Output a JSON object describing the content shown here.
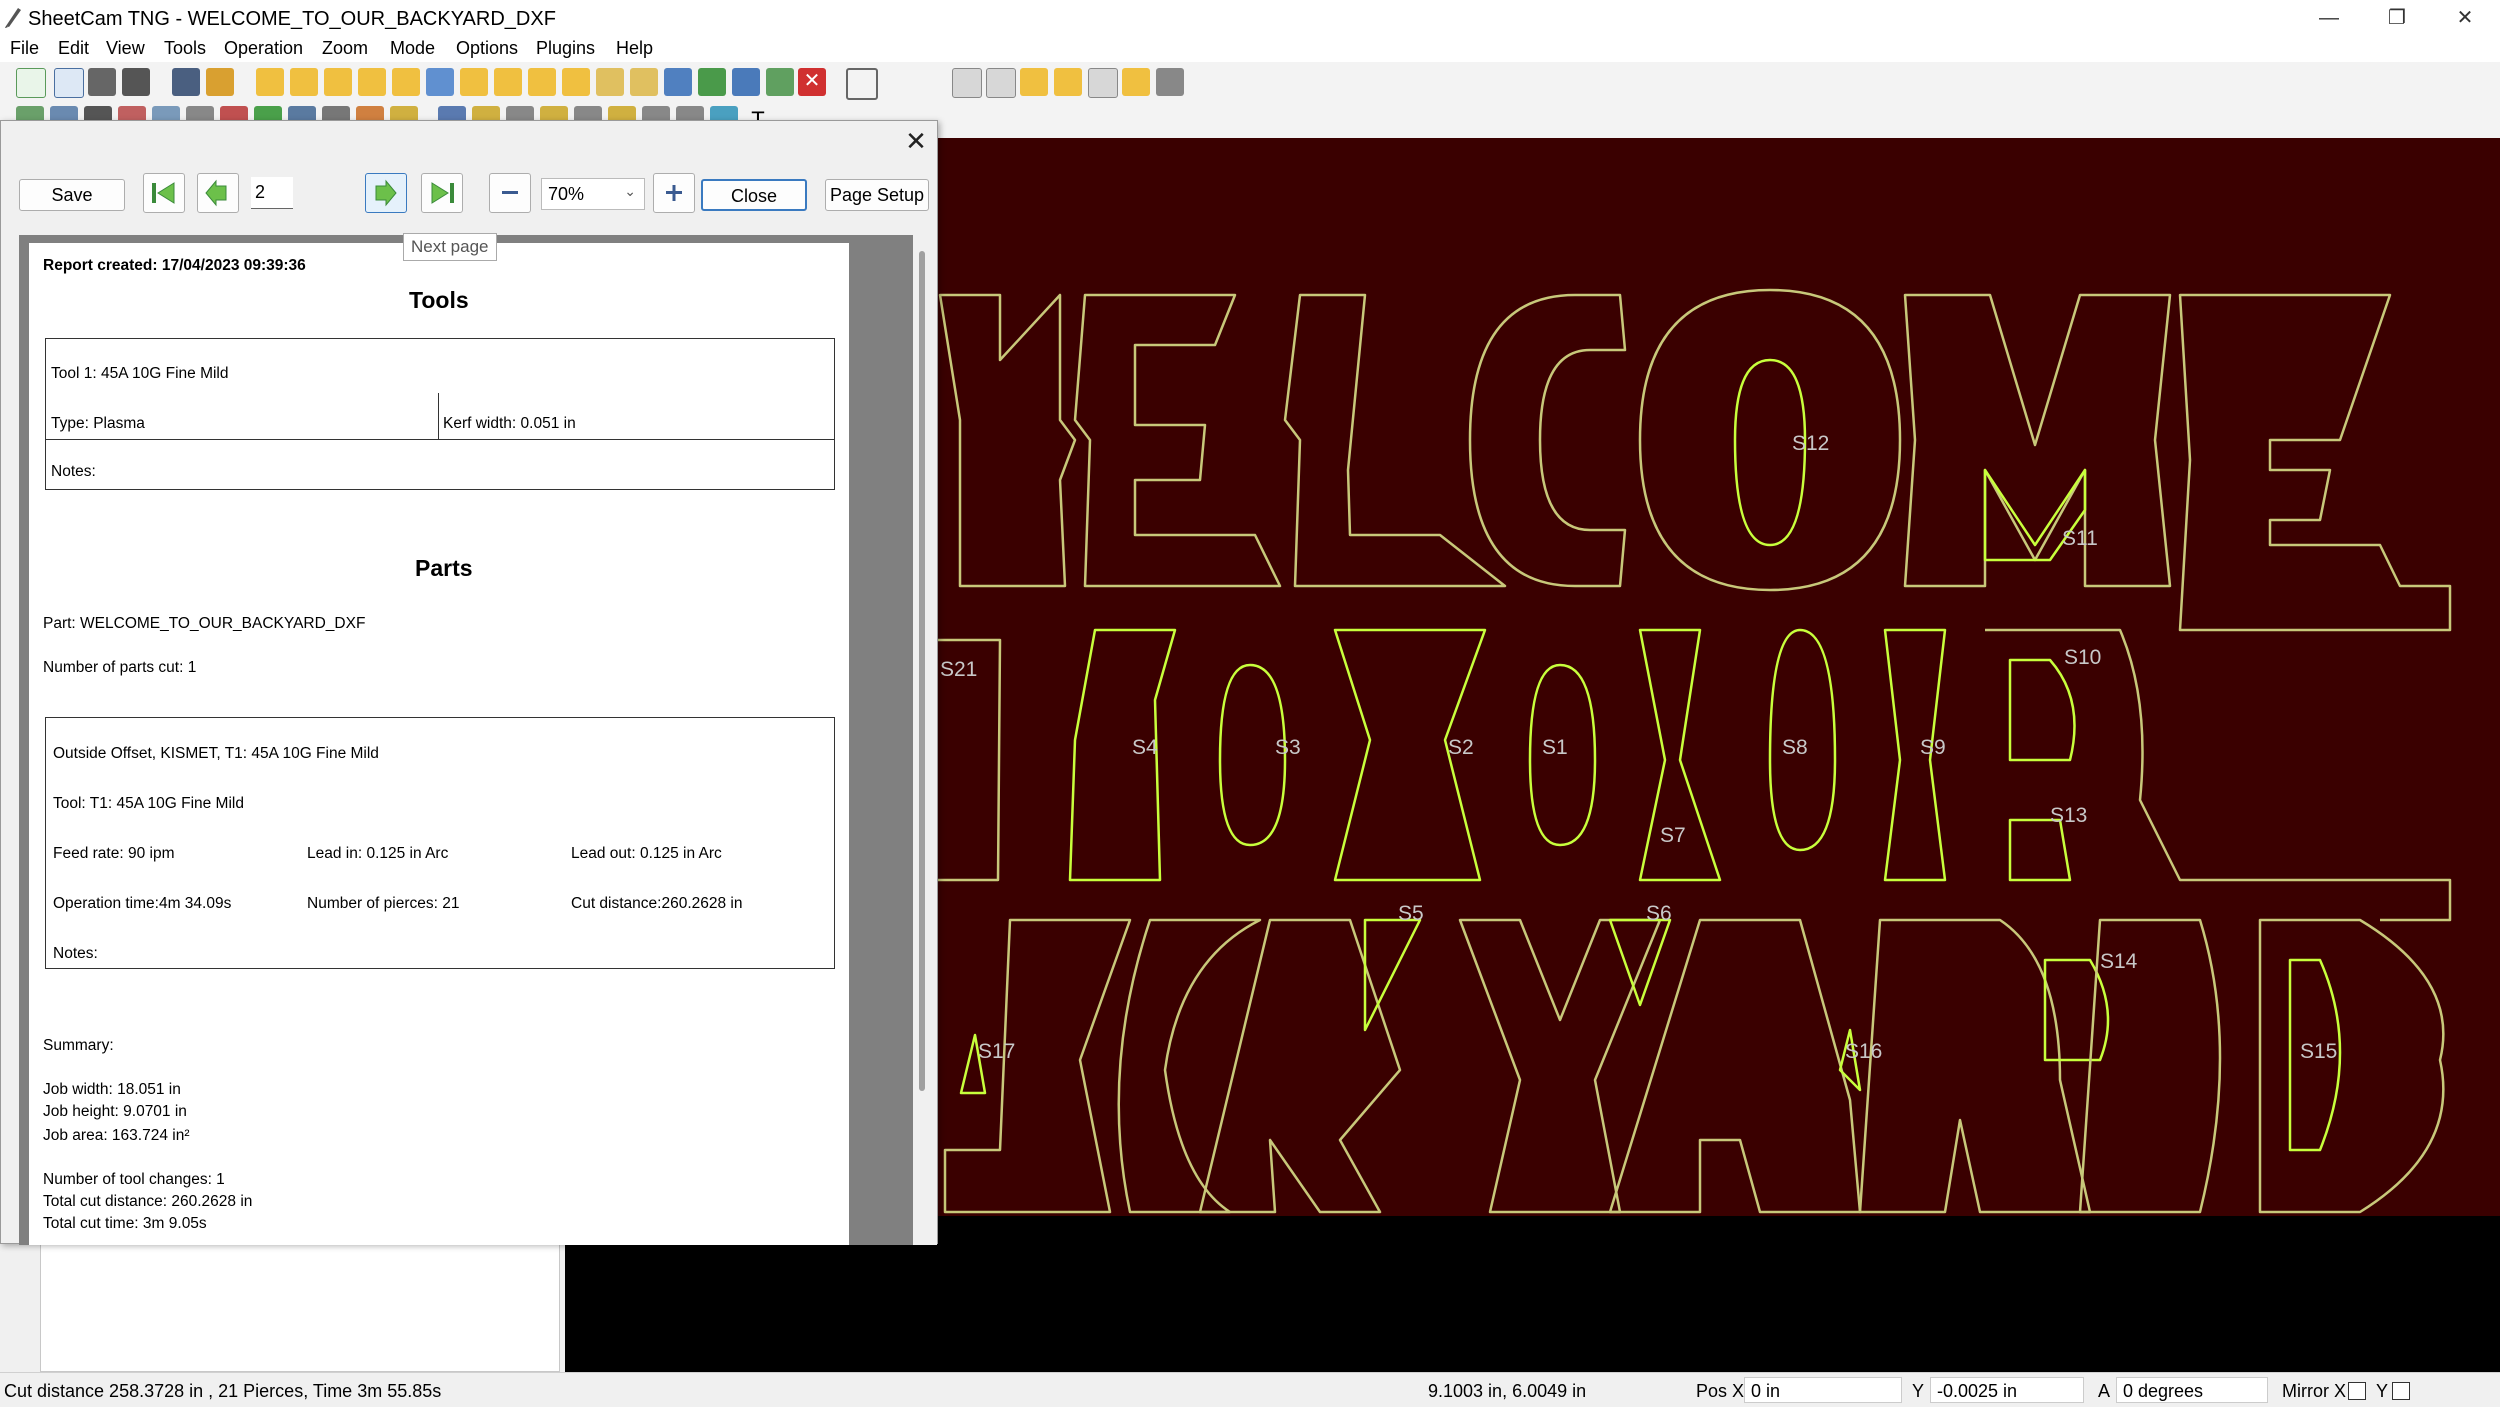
{
  "window": {
    "title": "SheetCam TNG - WELCOME_TO_OUR_BACKYARD_DXF",
    "minimize": "—",
    "restore": "❐",
    "close": "✕"
  },
  "menu": [
    "File",
    "Edit",
    "View",
    "Tools",
    "Operation",
    "Zoom",
    "Mode",
    "Options",
    "Plugins",
    "Help"
  ],
  "dialog": {
    "save_label": "Save",
    "page_number": "2",
    "zoom": "70%",
    "close_label": "Close",
    "page_setup_label": "Page Setup",
    "tooltip": "Next page",
    "close_icon": "✕"
  },
  "report": {
    "created": "Report created: 17/04/2023 09:39:36",
    "tools_heading": "Tools",
    "tool_name": "Tool 1: 45A 10G Fine Mild",
    "tool_type": "Type: Plasma",
    "kerf": "Kerf width: 0.051 in",
    "tool_notes": "Notes:",
    "parts_heading": "Parts",
    "part": "Part: WELCOME_TO_OUR_BACKYARD_DXF",
    "parts_cut": "Number of parts cut: 1",
    "op_name": "Outside Offset, KISMET, T1: 45A 10G Fine Mild",
    "op_tool": "Tool: T1: 45A 10G Fine Mild",
    "feed": "Feed rate: 90 ipm",
    "lead_in": "Lead in: 0.125 in Arc",
    "lead_out": "Lead out: 0.125 in Arc",
    "op_time": "Operation time:4m 34.09s",
    "pierces": "Number of pierces: 21",
    "cut_dist": "Cut distance:260.2628 in",
    "op_notes": "Notes:",
    "summary": "Summary:",
    "job_width": "Job width: 18.051 in",
    "job_height": "Job height: 9.0701 in",
    "job_area": "Job area: 163.724 in²",
    "tool_changes": "Number of tool changes: 1",
    "total_cut": "Total cut distance: 260.2628 in",
    "total_time": "Total cut time: 3m 9.05s"
  },
  "canvas": {
    "line1": "WELCOME",
    "line2": "TO OUR",
    "line3": "BACKYARD",
    "labels": [
      "S12",
      "S11",
      "S21",
      "S10",
      "S4",
      "S3",
      "S2",
      "S1",
      "S8",
      "S9",
      "S7",
      "S13",
      "S5",
      "S6",
      "S14",
      "S17",
      "S16",
      "S15"
    ],
    "colors": {
      "background": "#3a0000",
      "outline": "#c8c87a",
      "selected": "#c8ff3c"
    }
  },
  "status": {
    "summary": "Cut distance 258.3728 in , 21 Pierces, Time 3m 55.85s",
    "coords": "9.1003 in, 6.0049 in",
    "pos_x_label": "Pos X",
    "pos_x": "0 in",
    "y_label": "Y",
    "y": "-0.0025 in",
    "a_label": "A",
    "a": "0 degrees",
    "mirror_x_label": "Mirror X",
    "mirror_y_label": "Y"
  }
}
